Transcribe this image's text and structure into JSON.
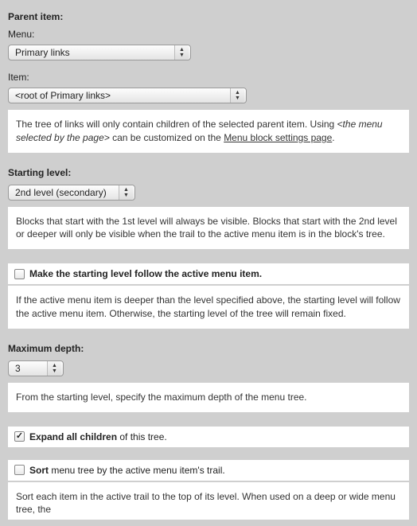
{
  "parent": {
    "label": "Parent item:",
    "menu_label": "Menu:",
    "menu_value": "Primary links",
    "item_label": "Item:",
    "item_value": "<root of Primary links>",
    "desc_prefix": "The tree of links will only contain children of the selected parent item. Using ",
    "desc_italic": "<the menu selected by the page>",
    "desc_mid": " can be customized on the ",
    "desc_link": "Menu block settings page",
    "desc_suffix": "."
  },
  "starting": {
    "label": "Starting level:",
    "value": "2nd level (secondary)",
    "desc": "Blocks that start with the 1st level will always be visible. Blocks that start with the 2nd level or deeper will only be visible when the trail to the active menu item is in the block's tree."
  },
  "follow": {
    "label_bold": "Make the starting level follow the active menu item.",
    "desc": "If the active menu item is deeper than the level specified above, the starting level will follow the active menu item. Otherwise, the starting level of the tree will remain fixed."
  },
  "depth": {
    "label": "Maximum depth:",
    "value": "3",
    "desc": "From the starting level, specify the maximum depth of the menu tree."
  },
  "expand": {
    "bold": "Expand all children",
    "rest": " of this tree."
  },
  "sort": {
    "bold": "Sort",
    "rest": " menu tree by the active menu item's trail.",
    "desc": "Sort each item in the active trail to the top of its level. When used on a deep or wide menu tree, the"
  }
}
